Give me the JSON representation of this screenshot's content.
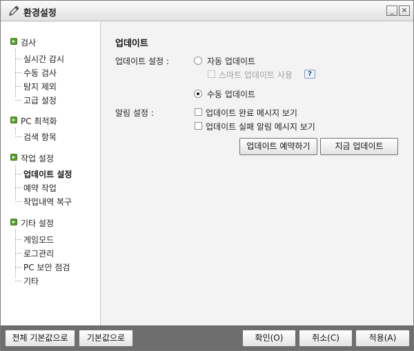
{
  "window": {
    "title": "환경설정",
    "minimize_label": "_",
    "close_label": "×"
  },
  "sidebar": {
    "groups": [
      {
        "label": "검사",
        "items": [
          "실시간 감시",
          "수동 검사",
          "탐지 제외",
          "고급 설정"
        ]
      },
      {
        "label": "PC 최적화",
        "items": [
          "검색 항목"
        ]
      },
      {
        "label": "작업 설정",
        "items": [
          "업데이트 설정",
          "예약 작업",
          "작업내역 복구"
        ]
      },
      {
        "label": "기타 설정",
        "items": [
          "게임모드",
          "로그관리",
          "PC 보안 점검",
          "기타"
        ]
      }
    ],
    "active_item": "업데이트 설정"
  },
  "main": {
    "section_title": "업데이트",
    "update_setting_label": "업데이트 설정 :",
    "auto_update": "자동 업데이트",
    "smart_update": "스마트 업데이트 사용",
    "help_label": "?",
    "manual_update": "수동 업데이트",
    "alert_setting_label": "알림 설정 :",
    "show_complete_msg": "업데이트 완료 메시지 보기",
    "show_fail_alert": "업데이트 실패 알림 메시지 보기",
    "schedule_button": "업데이트 예약하기",
    "update_now_button": "지금 업데이트",
    "selected_mode": "수동 업데이트"
  },
  "footer": {
    "reset_all": "전체 기본값으로",
    "reset_defaults": "기본값으로",
    "ok": "확인(O)",
    "cancel": "취소(C)",
    "apply": "적용(A)"
  }
}
